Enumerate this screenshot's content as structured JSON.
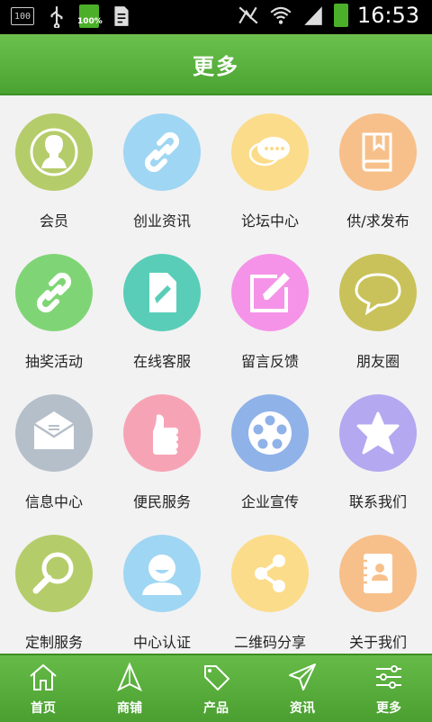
{
  "status_bar": {
    "time": "16:53",
    "battery_label": "100%",
    "box_label": "100"
  },
  "header": {
    "title": "更多"
  },
  "grid": [
    {
      "label": "会员",
      "icon": "member-icon",
      "color": "#b5cc6a"
    },
    {
      "label": "创业资讯",
      "icon": "link-icon",
      "color": "#9fd6f3"
    },
    {
      "label": "论坛中心",
      "icon": "chat-bubble-icon",
      "color": "#fbdc8a"
    },
    {
      "label": "供/求发布",
      "icon": "book-icon",
      "color": "#f7c08a"
    },
    {
      "label": "抽奖活动",
      "icon": "link-icon",
      "color": "#7fd575"
    },
    {
      "label": "在线客服",
      "icon": "edit-document-icon",
      "color": "#59cdb8"
    },
    {
      "label": "留言反馈",
      "icon": "pencil-square-icon",
      "color": "#f593e8"
    },
    {
      "label": "朋友圈",
      "icon": "speech-bubble-icon",
      "color": "#c9c25a"
    },
    {
      "label": "信息中心",
      "icon": "envelope-icon",
      "color": "#b5bfca"
    },
    {
      "label": "便民服务",
      "icon": "thumbs-up-icon",
      "color": "#f7a3b6"
    },
    {
      "label": "企业宣传",
      "icon": "film-reel-icon",
      "color": "#8fb2e8"
    },
    {
      "label": "联系我们",
      "icon": "star-icon",
      "color": "#b4a8f1"
    },
    {
      "label": "定制服务",
      "icon": "magnifier-icon",
      "color": "#b5cc6a"
    },
    {
      "label": "中心认证",
      "icon": "user-avatar-icon",
      "color": "#9fd6f3"
    },
    {
      "label": "二维码分享",
      "icon": "share-icon",
      "color": "#fbdc8a"
    },
    {
      "label": "关于我们",
      "icon": "contact-book-icon",
      "color": "#f7c08a"
    }
  ],
  "bottom_nav": [
    {
      "label": "首页",
      "icon": "home-icon"
    },
    {
      "label": "商铺",
      "icon": "shop-icon"
    },
    {
      "label": "产品",
      "icon": "sale-tag-icon"
    },
    {
      "label": "资讯",
      "icon": "send-icon"
    },
    {
      "label": "更多",
      "icon": "settings-sliders-icon"
    }
  ]
}
